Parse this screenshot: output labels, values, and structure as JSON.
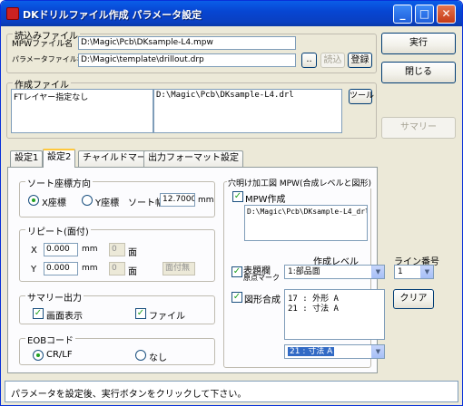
{
  "window": {
    "title": "DKドリルファイル作成 パラメータ設定",
    "controls": [
      "minimize",
      "maximize",
      "close"
    ]
  },
  "read_files": {
    "group_title": "読込みファイル",
    "mpw_label": "MPWファイル名",
    "mpw_value": "D:\\Magic\\Pcb\\DKsample-L4.mpw",
    "param_label": "パラメータファイル名",
    "param_value": "D:\\Magic\\template\\drillout.drp",
    "browse_label": "..",
    "load_label": "読込",
    "register_label": "登録"
  },
  "output_files": {
    "group_title": "作成ファイル",
    "left_list": [
      "FTレイヤー指定なし"
    ],
    "right_list": [
      "D:\\Magic\\Pcb\\DKsample-L4.drl"
    ],
    "tool_label": "ツール"
  },
  "side_buttons": {
    "run": "実行",
    "close": "閉じる",
    "summary": "サマリー"
  },
  "tabs": [
    "設定1",
    "設定2",
    "チャイルドマーク",
    "出力フォーマット設定"
  ],
  "sort": {
    "title": "ソート座標方向",
    "x": "X座標",
    "y": "Y座標",
    "width_label": "ソート幅",
    "width_value": "12.7000",
    "unit": "mm"
  },
  "repeat": {
    "title": "リピート(面付)",
    "x_label": "X",
    "x_value": "0.000",
    "y_label": "Y",
    "y_value": "0.000",
    "unit": "mm",
    "count_x": "0",
    "count_y": "0",
    "count_unit": "面",
    "no_panel": "面付無"
  },
  "summary_out": {
    "title": "サマリー出力",
    "screen": "画面表示",
    "file": "ファイル"
  },
  "eob": {
    "title": "EOBコード",
    "crlf": "CR/LF",
    "none": "なし"
  },
  "drill": {
    "title": "穴明け加工図 MPW(合成レベルと図形)",
    "mpw_create": "MPW作成",
    "mpw_file": "D:\\Magic\\Pcb\\DKsample-L4_drl.mpw",
    "level_header": "作成レベル",
    "line_header": "ライン番号",
    "title_block": "表題欄",
    "origin_mark": "原点マーク",
    "level_value": "1:部品面",
    "line_value": "1",
    "shape_merge": "図形合成",
    "shape_list": [
      "17 : 外形 A",
      "21 : 寸法 A"
    ],
    "clear": "クリア",
    "shape_select": "21 : 寸法 A"
  },
  "status": {
    "message": "パラメータを設定後、実行ボタンをクリックして下さい。"
  }
}
